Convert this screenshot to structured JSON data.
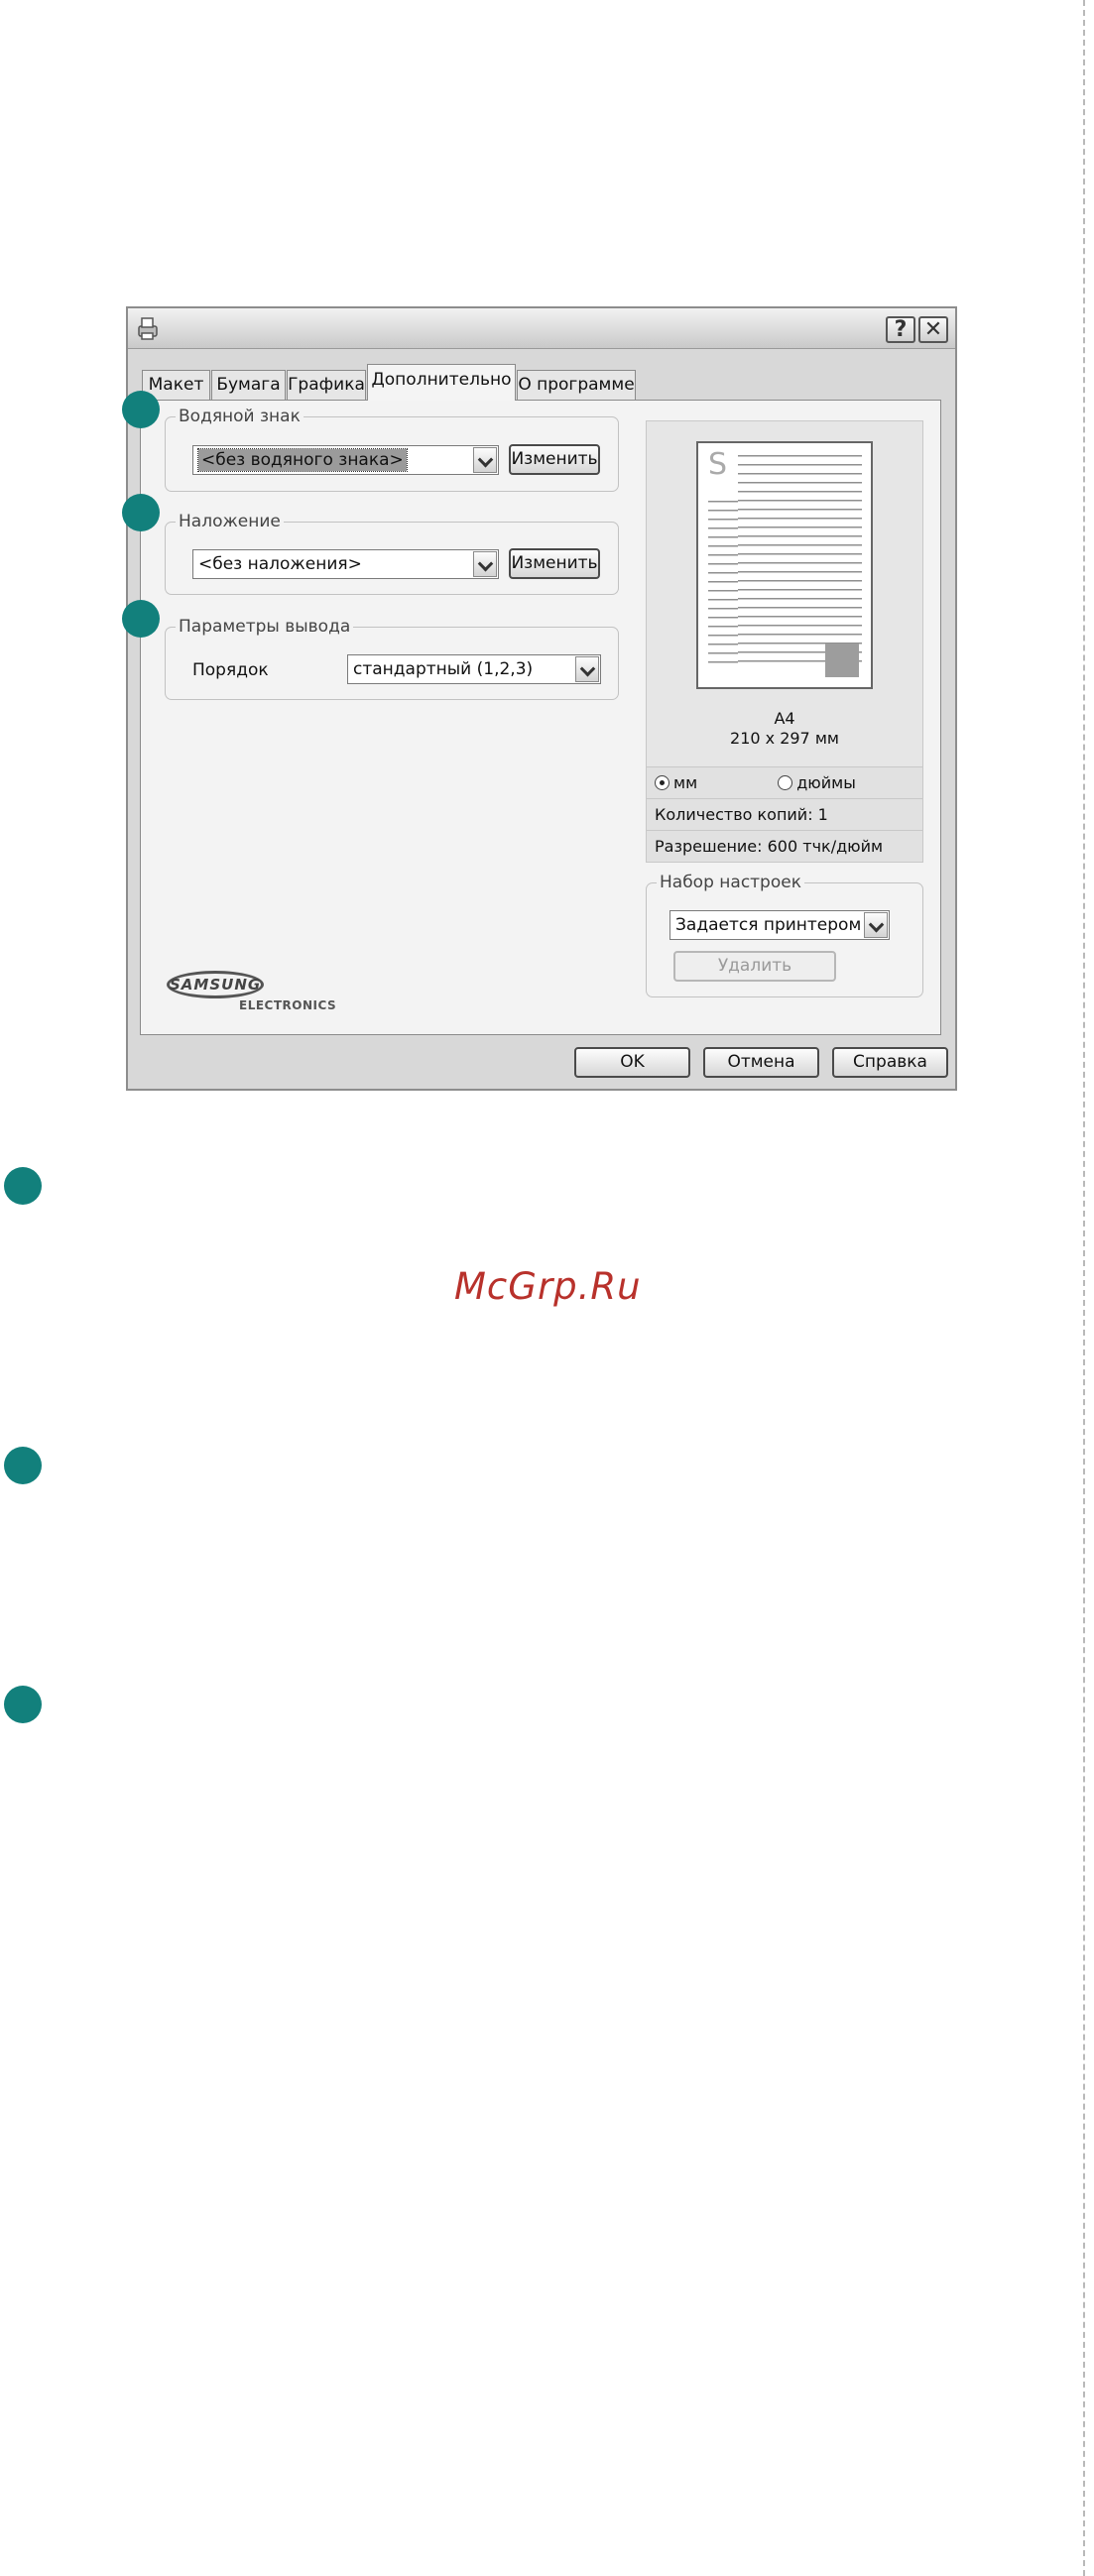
{
  "dialog": {
    "title_buttons": {
      "help": "?",
      "close": "✕"
    },
    "tabs": [
      {
        "label": "Макет"
      },
      {
        "label": "Бумага"
      },
      {
        "label": "Графика"
      },
      {
        "label": "Дополнительно",
        "active": true
      },
      {
        "label": "О программе"
      }
    ],
    "watermark_group": {
      "legend": "Водяной знак",
      "value": "<без водяного знака>",
      "edit_button": "Изменить"
    },
    "overlay_group": {
      "legend": "Наложение",
      "value": "<без наложения>",
      "edit_button": "Изменить"
    },
    "output_group": {
      "legend": "Параметры вывода",
      "order_label": "Порядок",
      "order_value": "стандартный (1,2,3)"
    },
    "preview": {
      "paper_name": "A4",
      "paper_size": "210 x 297 мм",
      "unit_mm": "мм",
      "unit_inches": "дюймы",
      "selected_unit": "мм",
      "copies": "Количество копий: 1",
      "resolution": "Разрешение: 600 тчк/дюйм",
      "page_letter": "S"
    },
    "presets": {
      "legend": "Набор настроек",
      "value": "Задается принтером",
      "delete_button": "Удалить"
    },
    "logo": {
      "brand": "SAMSUNG",
      "sub": "ELECTRONICS"
    },
    "footer": {
      "ok": "OK",
      "cancel": "Отмена",
      "help": "Справка"
    }
  },
  "watermark_text": "McGrp.Ru",
  "colors": {
    "marker": "#12807c",
    "watermark": "#b8312b"
  }
}
